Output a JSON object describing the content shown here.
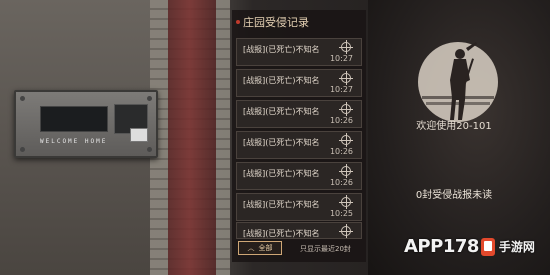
{
  "panel": {
    "title": "庄园受侵记录"
  },
  "records": [
    {
      "text": "[战报](已死亡)不知名",
      "time": "10:27"
    },
    {
      "text": "[战报](已死亡)不知名",
      "time": "10:27"
    },
    {
      "text": "[战报](已死亡)不知名",
      "time": "10:26"
    },
    {
      "text": "[战报](已死亡)不知名",
      "time": "10:26"
    },
    {
      "text": "[战报](已死亡)不知名",
      "time": "10:26"
    },
    {
      "text": "[战报](已死亡)不知名",
      "time": "10:25"
    },
    {
      "text": "[战报](已死亡)不知名",
      "time": ""
    }
  ],
  "filter": {
    "label": "全部",
    "hint": "只显示最近20封"
  },
  "info": {
    "welcome": "欢迎使用20-101",
    "unread": "0封受侵战报未读"
  },
  "device": {
    "label": "WELCOME  HOME"
  },
  "watermark": {
    "main": "APP178",
    "sub": "手游网"
  },
  "colors": {
    "accent": "#cfa776",
    "marker": "#c03a2c",
    "row_bg": "#2e2826"
  }
}
